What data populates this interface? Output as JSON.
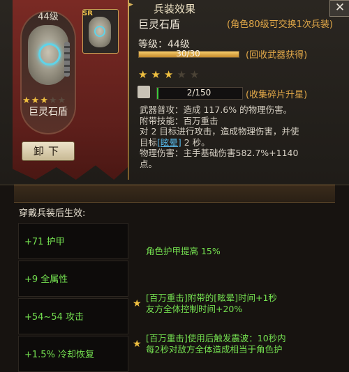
{
  "card": {
    "level": "44级",
    "name": "巨灵石盾",
    "stars_filled": 3,
    "stars_total": 5,
    "rarity_badge": "SR",
    "unequip_label": "卸下"
  },
  "weapon": {
    "title": "巨灵石盾",
    "exchange_note": "(角色80级可交换1次兵装)",
    "level_label": "等级：44级",
    "level_progress_text": "30/30",
    "level_progress": 1.0,
    "recycle_note": "(回收武器获得)",
    "stars_filled": 3,
    "stars_total": 5,
    "fragment_text": "2/150",
    "fragment_progress": 0.0133,
    "collect_note": "(收集碎片升星)",
    "desc_line1": "武器普攻：造成 117.6% 的物理伤害。",
    "desc_line2": "附带技能：百万重击",
    "desc_line3": "对 2 目标进行攻击，造成物理伤害，并使",
    "desc_line4_pre": "目标",
    "desc_line4_hl": "[眩晕]",
    "desc_line4_post": " 2 秒。",
    "desc_line5": "物理伤害：主手基础伤害582.7%+1140",
    "desc_line6": "点。"
  },
  "effect": {
    "title": "兵装效果",
    "subtitle": "穿戴兵装后生效:",
    "stats": [
      "+71 护甲",
      "+9 全属性",
      "+54~54 攻击",
      "+1.5% 冷却恢复"
    ],
    "bonus1": "角色护甲提高 15%",
    "bonus2_line1": "[百万重击]附带的[眩晕]时间+1秒",
    "bonus2_line2": "友方全体控制时间+20%",
    "bonus3_line1": "[百万重击]使用后触发震波：10秒内",
    "bonus3_line2": "每2秒对敌方全体造成相当于角色护"
  },
  "colors": {
    "accent_orange": "#e2a848",
    "stat_green": "#74e050",
    "keyword_blue": "#57b8e8",
    "star_gold": "#f0c040",
    "banner_red": "#7a2a24"
  },
  "icons": {
    "close": "close-icon",
    "fragment": "puzzle-icon",
    "star": "star-icon"
  }
}
